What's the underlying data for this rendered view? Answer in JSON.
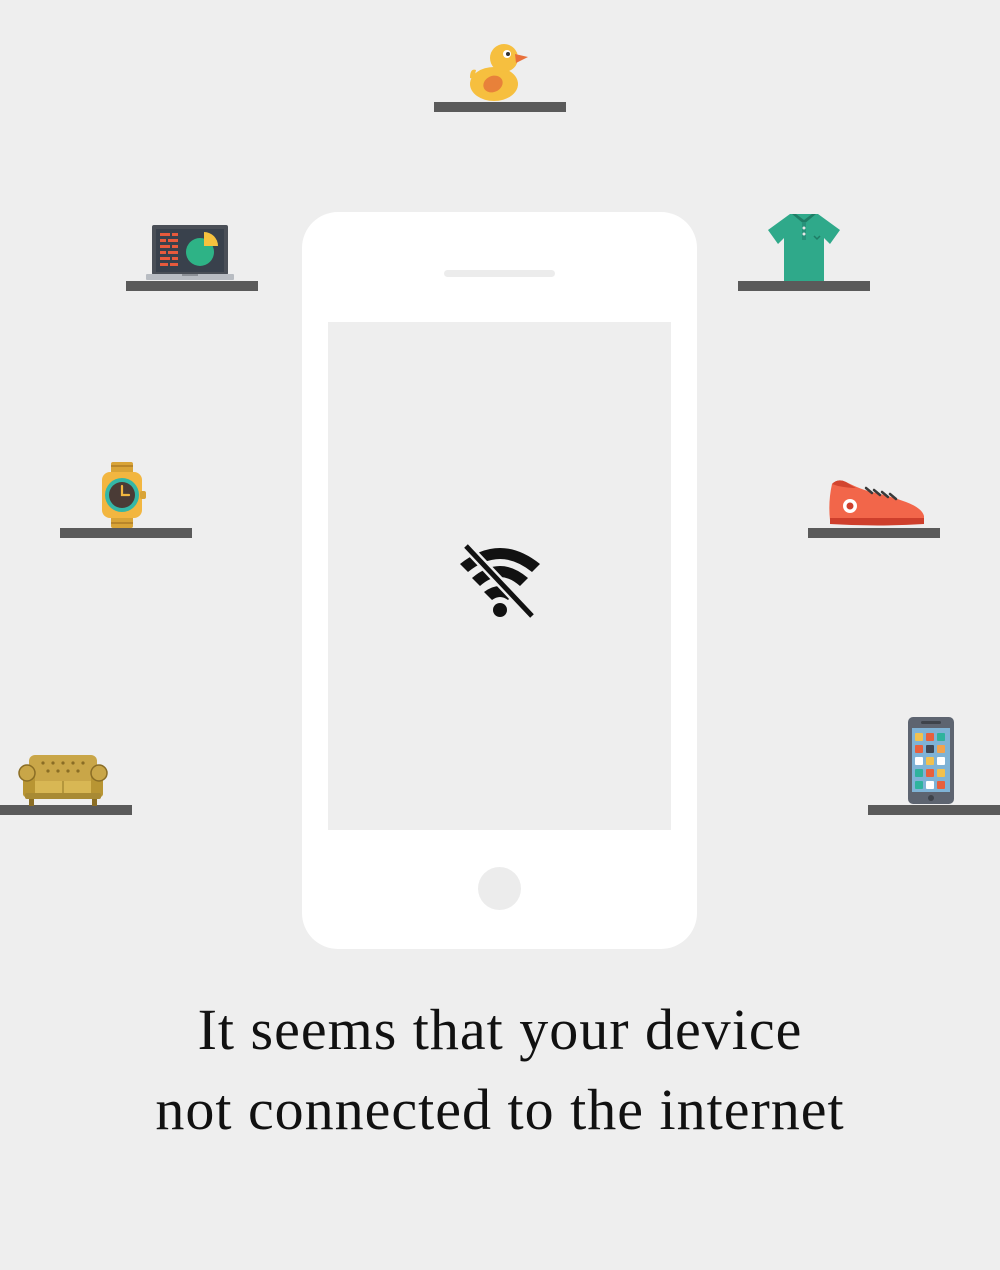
{
  "message": {
    "line1": "It seems that your device",
    "line2": "not connected to the internet"
  },
  "icons": {
    "status": "wifi-off-icon",
    "shelf_items": [
      "rubber-duck-icon",
      "laptop-icon",
      "polo-shirt-icon",
      "wristwatch-icon",
      "sneaker-icon",
      "sofa-icon",
      "smartphone-icon"
    ]
  },
  "colors": {
    "background": "#eeeeee",
    "shelf": "#5a5a5a",
    "phone_body": "#ffffff"
  }
}
